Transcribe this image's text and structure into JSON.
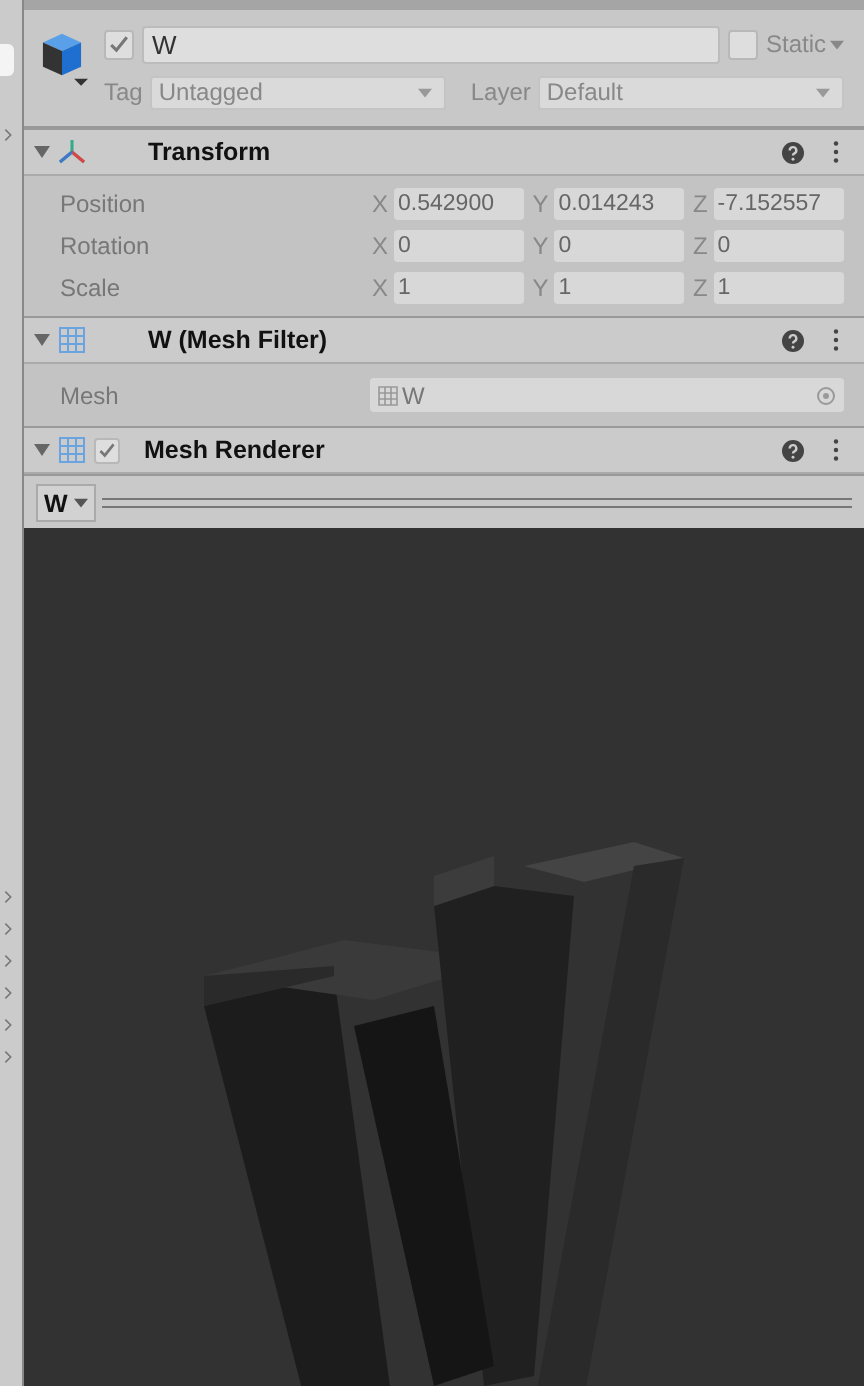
{
  "object": {
    "active": true,
    "name": "W",
    "static": false,
    "static_label": "Static",
    "tag_label": "Tag",
    "tag": "Untagged",
    "layer_label": "Layer",
    "layer": "Default"
  },
  "components": [
    {
      "kind": "transform",
      "title": "Transform",
      "expanded": true,
      "rows": [
        {
          "label": "Position",
          "fields": [
            {
              "axis": "X",
              "value": "0.542900"
            },
            {
              "axis": "Y",
              "value": "0.014243"
            },
            {
              "axis": "Z",
              "value": "-7.152557"
            }
          ]
        },
        {
          "label": "Rotation",
          "fields": [
            {
              "axis": "X",
              "value": "0"
            },
            {
              "axis": "Y",
              "value": "0"
            },
            {
              "axis": "Z",
              "value": "0"
            }
          ]
        },
        {
          "label": "Scale",
          "fields": [
            {
              "axis": "X",
              "value": "1"
            },
            {
              "axis": "Y",
              "value": "1"
            },
            {
              "axis": "Z",
              "value": "1"
            }
          ]
        }
      ]
    },
    {
      "kind": "mesh_filter",
      "title": "W (Mesh Filter)",
      "expanded": true,
      "mesh_label": "Mesh",
      "mesh_value": "W"
    },
    {
      "kind": "mesh_renderer",
      "title": "Mesh Renderer",
      "expanded": true,
      "enabled": true
    }
  ],
  "preview": {
    "selector": "W"
  }
}
